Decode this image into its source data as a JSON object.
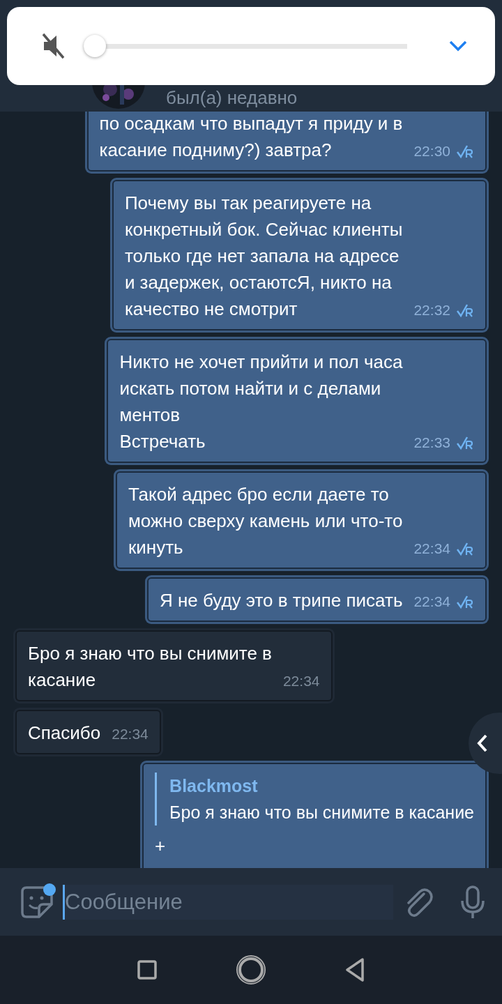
{
  "volume_panel": {
    "muted": true,
    "level": 0
  },
  "header": {
    "status": "был(а) недавно"
  },
  "messages": [
    {
      "kind": "outgoing",
      "text": "по осадкам что выпадут я приду и в\nкасание подниму?) завтра?",
      "time": "22:30",
      "read": true
    },
    {
      "kind": "outgoing",
      "text": "Почему вы так реагируете на\nконкретный бок. Сейчас клиенты\nтолько где нет запала на адресе\nи задержек, остаютсЯ, никто на\nкачество не смотрит",
      "time": "22:32",
      "read": true
    },
    {
      "kind": "outgoing",
      "text": "Никто не хочет прийти и пол часа\nискать потом найти и с делами\nментов\nВстречать",
      "time": "22:33",
      "read": true
    },
    {
      "kind": "outgoing",
      "text": "Такой адрес бро если даете то\nможно сверху камень или что-то\nкинуть",
      "time": "22:34",
      "read": true
    },
    {
      "kind": "outgoing",
      "text": "Я не буду это в трипе писать",
      "time": "22:34",
      "read": true
    },
    {
      "kind": "incoming",
      "text": "Бро я знаю что вы снимите в\nкасание",
      "time": "22:34"
    },
    {
      "kind": "incoming",
      "text": "Спасибо",
      "time": "22:34"
    },
    {
      "kind": "reply",
      "reply_author": "Blackmost",
      "reply_text": "Бро я знаю что вы снимите в касание",
      "text": "+"
    }
  ],
  "composer": {
    "placeholder": "Сообщение",
    "sticker_badge": true
  }
}
